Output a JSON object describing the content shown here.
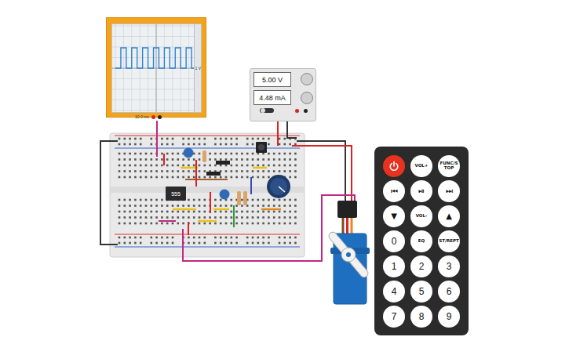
{
  "oscilloscope": {
    "timebase": "10.0 ms",
    "scale": "1 V",
    "waveform": {
      "values": [
        0,
        1,
        0,
        1,
        0,
        1,
        0,
        1,
        0,
        1,
        0,
        1,
        0,
        1,
        0
      ]
    }
  },
  "power_supply": {
    "voltage": "5.00 V",
    "current": "4.48 mA",
    "on": true
  },
  "breadboard": {
    "chip": {
      "label": "555"
    }
  },
  "remote": {
    "keys": [
      {
        "kind": "power",
        "label": ""
      },
      {
        "kind": "label",
        "label": "VOL+"
      },
      {
        "kind": "label",
        "label": "FUNC/STOP"
      },
      {
        "kind": "symbol",
        "label": "⏮"
      },
      {
        "kind": "symbol",
        "label": "⏯"
      },
      {
        "kind": "symbol",
        "label": "⏭"
      },
      {
        "kind": "symbol",
        "label": "▼"
      },
      {
        "kind": "label",
        "label": "VOL-"
      },
      {
        "kind": "symbol",
        "label": "▲"
      },
      {
        "kind": "digit",
        "label": "0"
      },
      {
        "kind": "label",
        "label": "EQ"
      },
      {
        "kind": "label",
        "label": "ST/REPT"
      },
      {
        "kind": "digit",
        "label": "1"
      },
      {
        "kind": "digit",
        "label": "2"
      },
      {
        "kind": "digit",
        "label": "3"
      },
      {
        "kind": "digit",
        "label": "4"
      },
      {
        "kind": "digit",
        "label": "5"
      },
      {
        "kind": "digit",
        "label": "6"
      },
      {
        "kind": "digit",
        "label": "7"
      },
      {
        "kind": "digit",
        "label": "8"
      },
      {
        "kind": "digit",
        "label": "9"
      }
    ]
  }
}
